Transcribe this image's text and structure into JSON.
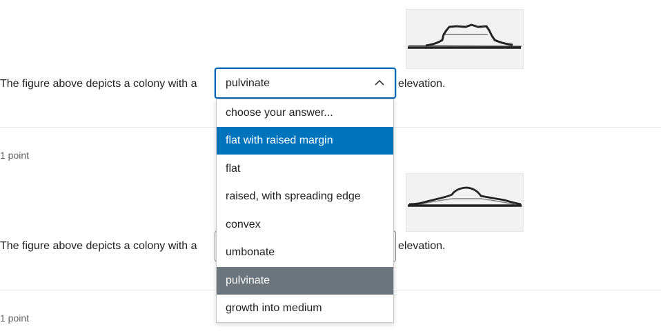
{
  "questions": [
    {
      "prefix": "The figure above depicts a colony with a",
      "suffix": "elevation.",
      "selected_value": "pulvinate",
      "points": "1 point"
    },
    {
      "prefix": "The figure above depicts a colony with a",
      "suffix": "elevation.",
      "points": "1 point"
    }
  ],
  "dropdown": {
    "options": [
      "choose your answer...",
      "flat with raised margin",
      "flat",
      "raised, with spreading edge",
      "convex",
      "umbonate",
      "pulvinate",
      "growth into medium"
    ],
    "highlighted_option": "flat with raised margin",
    "selected_option": "pulvinate"
  },
  "icons": {
    "select_chevron": "chevron-up-icon"
  },
  "colors": {
    "focus_border": "#0066b2",
    "hover_option_bg": "#0073bd",
    "selected_option_bg": "#6b757d"
  }
}
